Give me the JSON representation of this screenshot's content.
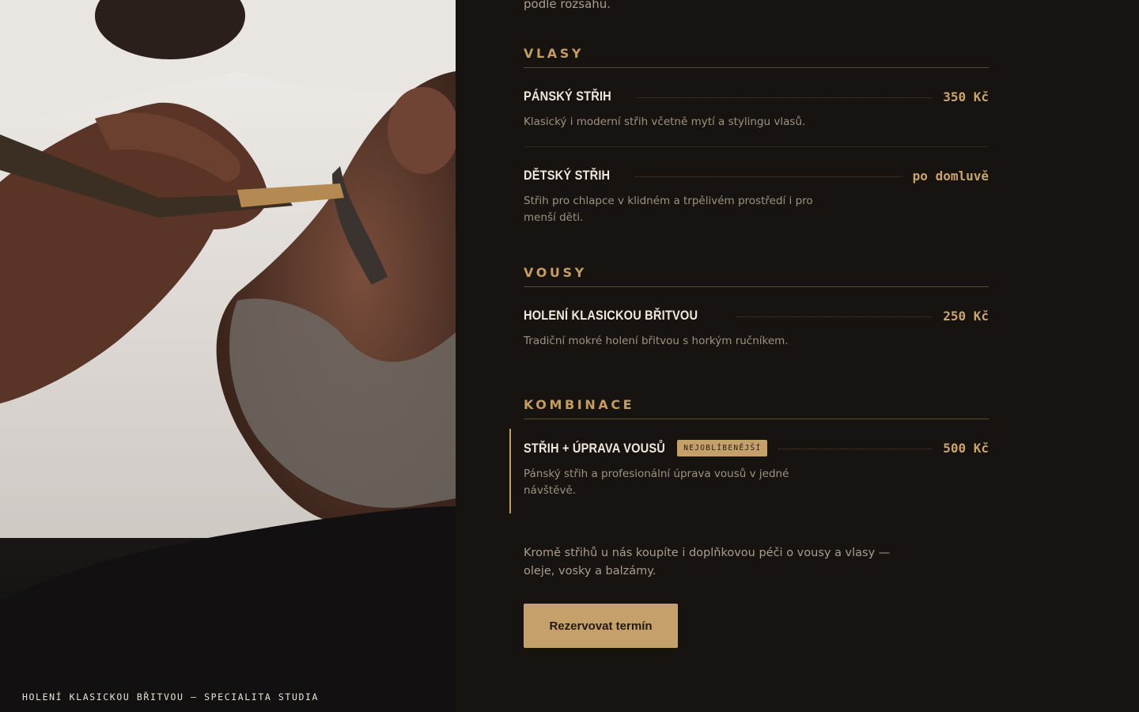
{
  "photo": {
    "caption": "HOLENÍ KLASICKOU BŘITVOU — SPECIALITA STUDIA"
  },
  "intro": {
    "tail": "podle rozsahu."
  },
  "sections": [
    {
      "title": "VLASY",
      "items": [
        {
          "name": "PÁNSKÝ STŘIH",
          "price": "350 Kč",
          "description": "Klasický i moderní střih včetně mytí a stylingu vlasů."
        },
        {
          "name": "DĚTSKÝ STŘIH",
          "price": "po domluvě",
          "description": "Střih pro chlapce v klidném a trpělivém prostředí i pro menší děti."
        }
      ]
    },
    {
      "title": "VOUSY",
      "items": [
        {
          "name": "HOLENÍ KLASICKOU BŘITVOU",
          "price": "250 Kč",
          "description": "Tradiční mokré holení břitvou s horkým ručníkem."
        }
      ]
    },
    {
      "title": "KOMBINACE",
      "items": [
        {
          "name": "STŘIH + ÚPRAVA VOUSŮ",
          "badge": "NEJOBLÍBENĚJŠÍ",
          "price": "500 Kč",
          "description": "Pánský střih a profesionální úprava vousů v jedné návštěvě."
        }
      ]
    }
  ],
  "extra_note": "Kromě střihů u nás koupíte i doplňkovou péči o vousy a vlasy — oleje, vosky a balzámy.",
  "cta": {
    "label": "Rezervovat termín"
  },
  "colors": {
    "background": "#171310",
    "accent": "#c5a06a",
    "text": "#efe8dc",
    "muted": "#9d9281"
  }
}
